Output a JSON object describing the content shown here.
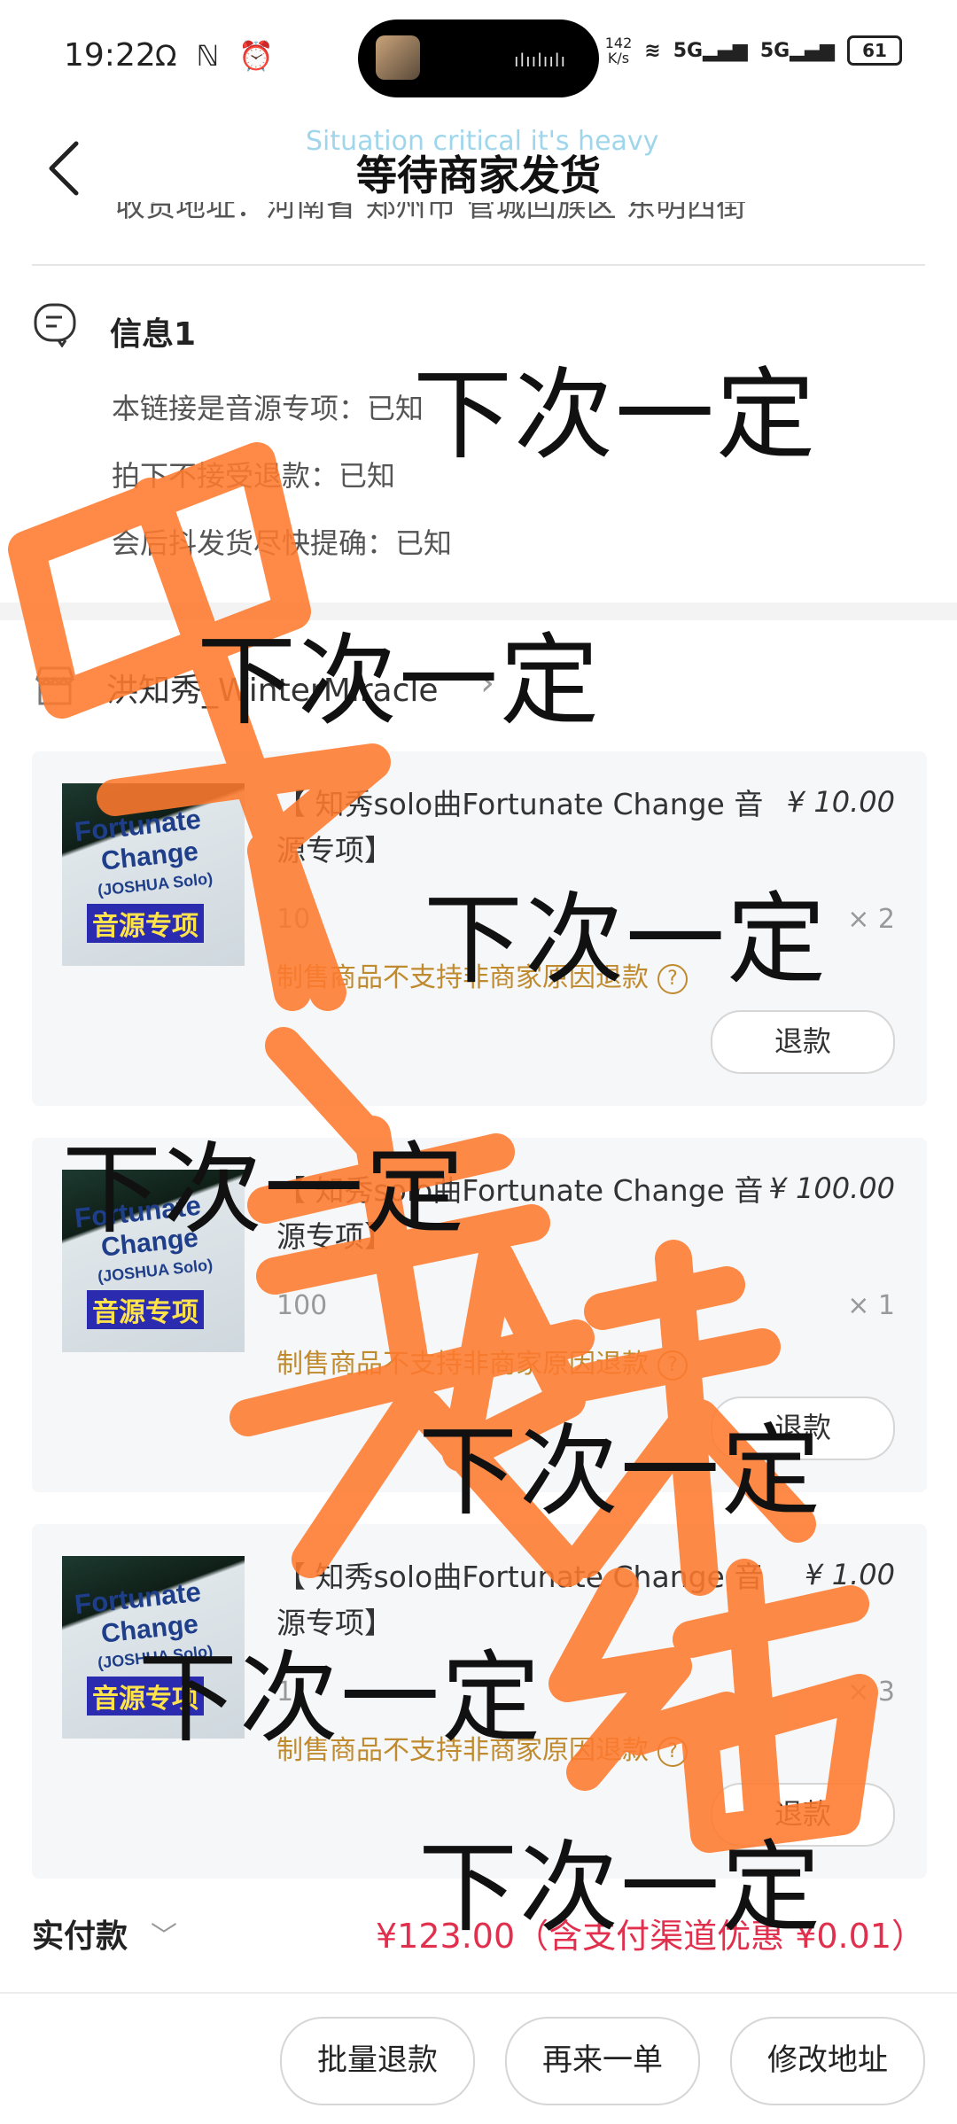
{
  "status_bar": {
    "time": "19:22",
    "left_icons": "Ω ℕ ⏰",
    "net_speed_top": "142",
    "net_speed_bottom": "K/s",
    "signal_1": "5G",
    "signal_2": "5G",
    "battery": "61"
  },
  "header": {
    "title": "等待商家发货",
    "lyric_overlay": "Situation critical it's heavy",
    "cut_address": "收货地址：河南省 郑州市 管城回族区 东明西街"
  },
  "info": {
    "title": "信息1",
    "lines": [
      "本链接是音源专项：已知",
      "拍下不接受退款：已知",
      "会后抖发货尽快提确：已知"
    ]
  },
  "shop": {
    "name": "洪知秀_WinterMiracle"
  },
  "items": [
    {
      "title": "【 知秀solo曲Fortunate Change 音源专项】",
      "price": "¥ 10.00",
      "spec": "10",
      "qty": "× 2",
      "note": "制售商品不支持非商家原因退款",
      "refund_label": "退款",
      "thumb_text": [
        "Fortunate",
        "Change",
        "(JOSHUA Solo)",
        "音源专项"
      ]
    },
    {
      "title": "【 知秀solo曲Fortunate Change 音源专项】",
      "price": "¥ 100.00",
      "spec": "100",
      "qty": "× 1",
      "note": "制售商品不支持非商家原因退款",
      "refund_label": "退款",
      "thumb_text": [
        "Fortunate",
        "Change",
        "(JOSHUA Solo)",
        "音源专项"
      ]
    },
    {
      "title": "【 知秀solo曲Fortunate Change 音源专项】",
      "price": "¥ 1.00",
      "spec": "1",
      "qty": "× 3",
      "note": "制售商品不支持非商家原因退款",
      "refund_label": "退款",
      "thumb_text": [
        "Fortunate",
        "Change",
        "(JOSHUA Solo)",
        "音源专项"
      ]
    }
  ],
  "total": {
    "label": "实付款",
    "amount": "¥123.00（含支付渠道优惠 ¥0.01）"
  },
  "bottom_actions": {
    "batch_refund": "批量退款",
    "reorder": "再来一单",
    "change_address": "修改地址"
  },
  "watermark": {
    "text": "下次一定",
    "handwritten": "中了美味结"
  },
  "colors": {
    "accent_price": "#e0304e",
    "note": "#c08a2e",
    "watermark_stroke": "#ff7a2e"
  }
}
